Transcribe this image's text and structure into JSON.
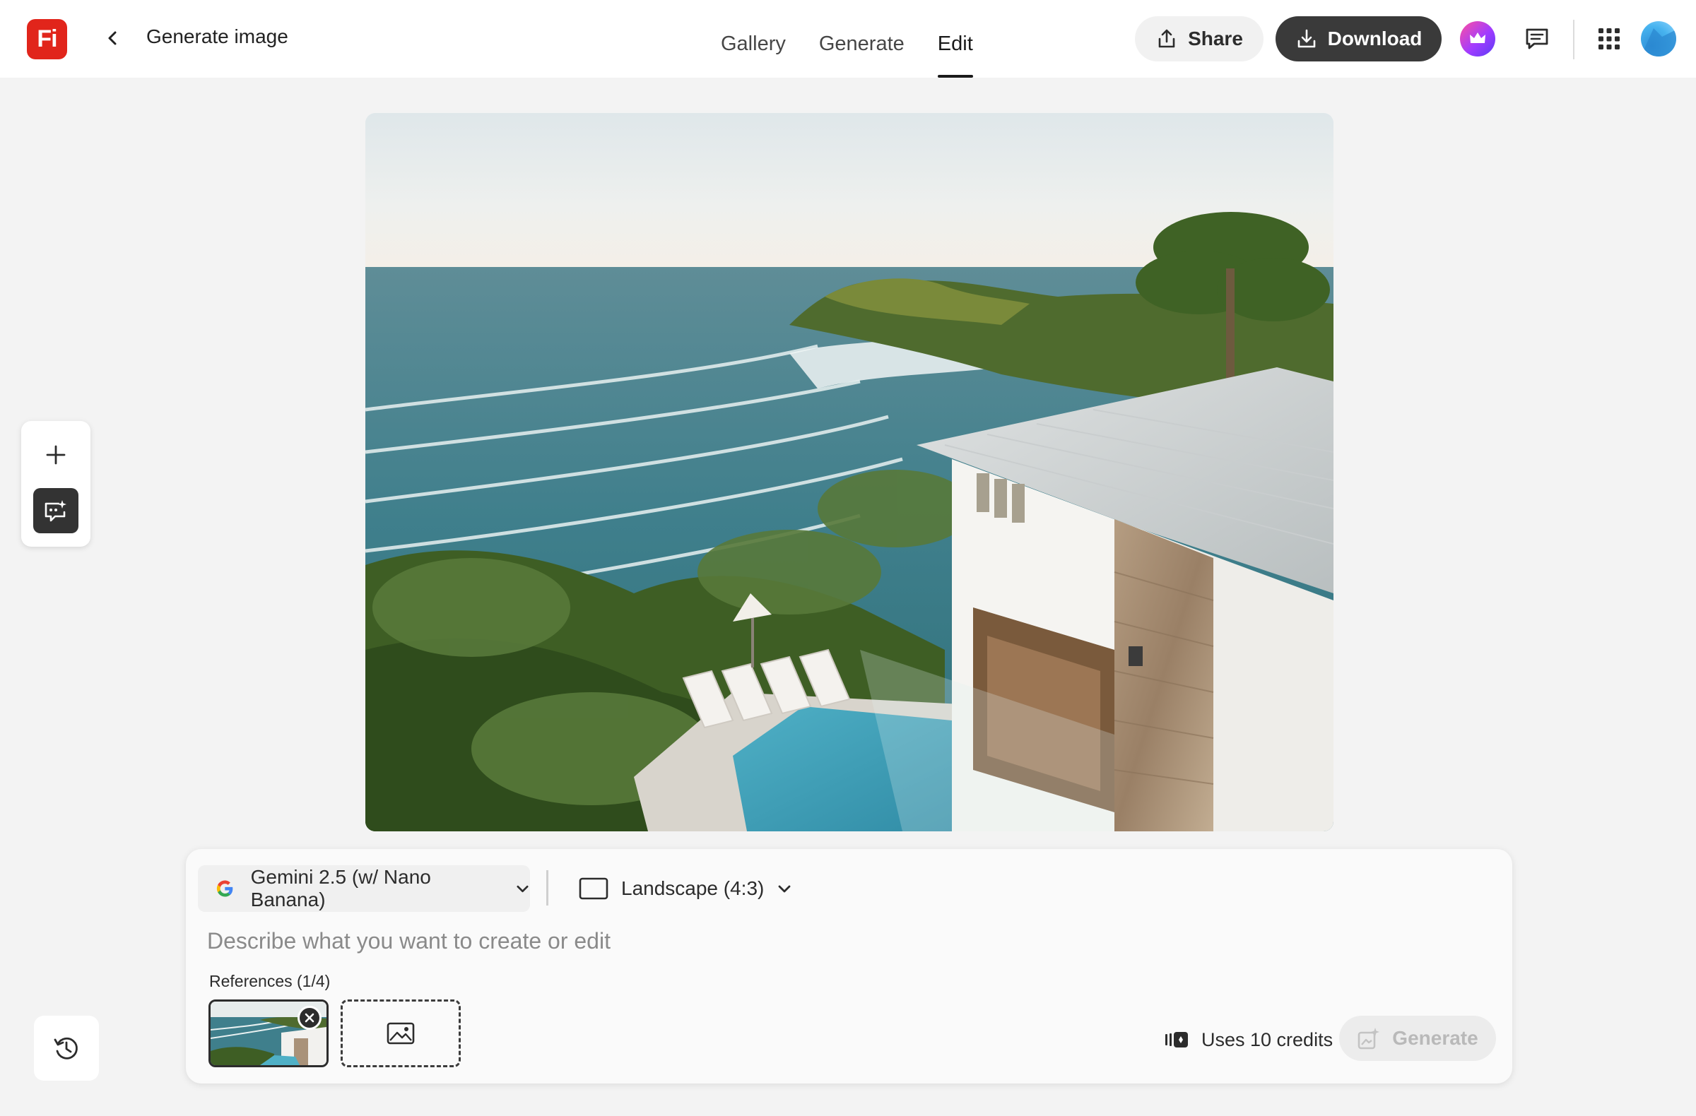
{
  "app": {
    "logo_text": "Fi",
    "page_title": "Generate image"
  },
  "header": {
    "tabs": [
      {
        "label": "Gallery",
        "active": false
      },
      {
        "label": "Generate",
        "active": false
      },
      {
        "label": "Edit",
        "active": true
      }
    ],
    "share_label": "Share",
    "download_label": "Download"
  },
  "icons": {
    "back": "chevron-left-icon",
    "share": "share-icon",
    "download": "download-icon",
    "premium": "crown-icon",
    "chat": "chat-icon",
    "apps": "apps-grid-icon",
    "add": "plus-icon",
    "prompt_tool": "prompt-sparkle-icon",
    "history": "history-icon",
    "model_brand": "google-icon",
    "ratio": "landscape-frame-icon",
    "credits": "credits-icon",
    "generate": "generate-sparkle-icon",
    "add_image": "image-icon"
  },
  "colors": {
    "logo": "#e1251b",
    "download_bg": "#3a3a3a",
    "generate_disabled_text": "#b9b9b9"
  },
  "prompt": {
    "model_label": "Gemini 2.5 (w/ Nano Banana)",
    "ratio_label": "Landscape (4:3)",
    "placeholder": "Describe what you want to create or edit",
    "value": "",
    "references_label": "References (1/4)",
    "credits_label": "Uses 10 credits",
    "generate_label": "Generate",
    "generate_enabled": false
  }
}
